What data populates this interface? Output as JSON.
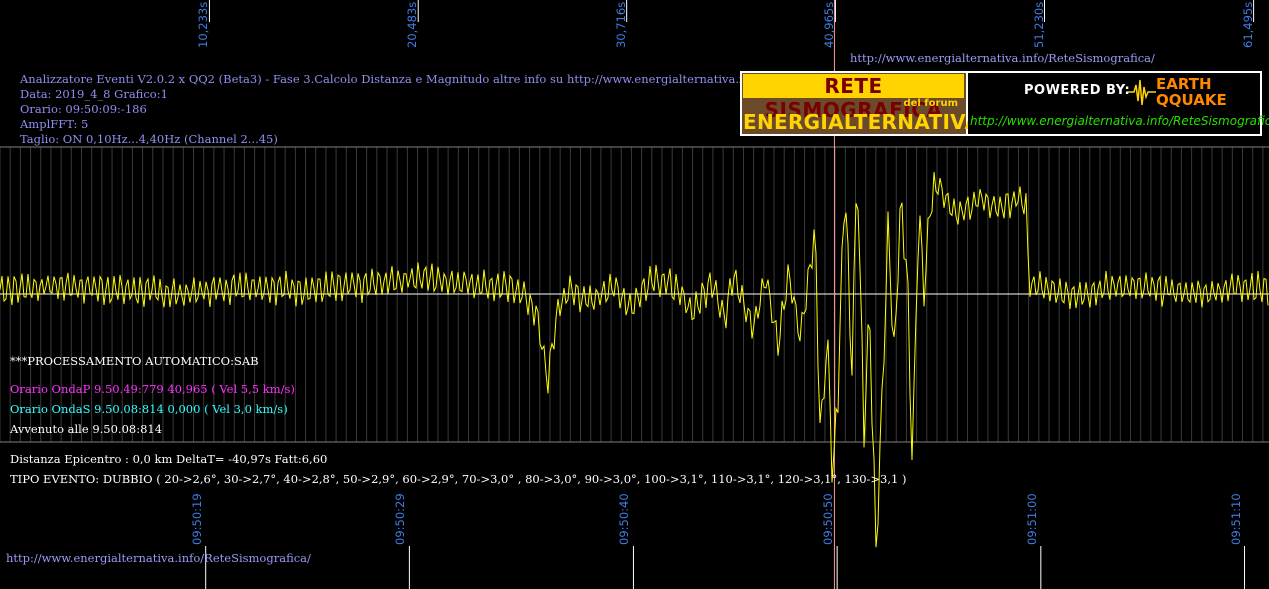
{
  "header": {
    "line1": "Analizzatore Eventi V2.0.2 x QQ2 (Beta3) - Fase 3.Calcolo Distanza e Magnitudo altre info su http://www.energialternativa.info/ReteSism",
    "line2": "Data: 2019_4_8 Grafico:1",
    "line3": "Orario: 09:50:09:-186",
    "line4": "AmplFFT: 5",
    "line5": "Taglio: ON 0,10Hz...4,40Hz       (Channel 2...45)"
  },
  "top_url": "http://www.energialternativa.info/ReteSismografica/",
  "bottom_url": "http://www.energialternativa.info/ReteSismografica/",
  "logo": {
    "title_top": "RETE SISMOGRAFICA",
    "subtitle": "del forum",
    "title_bottom": "ENERGIALTERNATIVA",
    "powered": "POWERED BY:",
    "brand_a": "EARTH",
    "brand_b": "QQUAKE",
    "url": "http://www.energialternativa.info/ReteSismografica"
  },
  "processing": {
    "title": "***PROCESSAMENTO AUTOMATICO:SAB",
    "p_wave": "Orario OndaP 9.50.49:779  40,965 ( Vel 5,5 km/s)",
    "s_wave": "Orario OndaS 9.50.08:814  0,000 ( Vel 3,0 km/s)",
    "occurred": "Avvenuto alle 9.50.08:814",
    "distance": "Distanza Epicentro : 0,0 km DeltaT= -40,97s  Fatt:6,60",
    "event_type": "TIPO EVENTO: DUBBIO ( 20->2,6°, 30->2,7°, 40->2,8°, 50->2,9°, 60->2,9°, 70->3,0° , 80->3,0°, 90->3,0°, 100->3,1°, 110->3,1°, 120->3,1°, 130->3,1 )"
  },
  "colors": {
    "background": "#000000",
    "signal": "#ffff00",
    "p_marker": "#ff9999",
    "p_text": "#ff33ff",
    "s_text": "#33ffff",
    "axis_label": "#3f7fe6",
    "grid": "#3a3a3a"
  },
  "chart_data": {
    "type": "line",
    "top_ticks": [
      "10,233s",
      "20,483s",
      "30,716s",
      "40,965s",
      "51,230s",
      "61,495s"
    ],
    "bottom_ticks": [
      "09:50:19",
      "09:50:29",
      "09:50:40",
      "09:50:50",
      "09:51:00",
      "09:51:10"
    ],
    "x_range_s": [
      0,
      62.3
    ],
    "p_marker_s": 40.965,
    "y_range": [
      -6.5,
      3.5
    ],
    "x": [
      0,
      3,
      6,
      9,
      12,
      15,
      18,
      20.5,
      22,
      24,
      25.5,
      26.3,
      26.9,
      27.4,
      28,
      29,
      30,
      31,
      32,
      33,
      34,
      35,
      35.6,
      36,
      37,
      37.6,
      38.2,
      38.7,
      39.3,
      40,
      40.3,
      40.6,
      40.9,
      41.2,
      41.5,
      41.8,
      42.1,
      42.4,
      42.7,
      43.0,
      43.3,
      43.6,
      43.9,
      44.2,
      44.5,
      44.8,
      45.1,
      45.4,
      45.7,
      46,
      47,
      48,
      49,
      50,
      50.4,
      50.5,
      51.5,
      53,
      55,
      57,
      59,
      61,
      62.3
    ],
    "y": [
      0.1,
      0.2,
      0.1,
      0.0,
      0.2,
      0.1,
      0.2,
      0.4,
      0.3,
      0.2,
      0.1,
      -0.4,
      -2.0,
      -0.3,
      0.1,
      -0.2,
      0.2,
      -0.3,
      0.4,
      0.2,
      -0.4,
      0.3,
      -0.6,
      0.5,
      -0.8,
      0.4,
      -1.2,
      0.5,
      -1.0,
      1.5,
      -3.5,
      -0.8,
      -4.5,
      -1.5,
      2.8,
      -2.0,
      3.0,
      -3.2,
      -0.5,
      -6.0,
      -2.5,
      1.6,
      -1.5,
      2.0,
      0.8,
      -3.8,
      1.8,
      0.2,
      2.3,
      2.6,
      1.8,
      2.2,
      2.0,
      2.2,
      2.1,
      0.2,
      0.1,
      0.0,
      0.2,
      0.1,
      0.0,
      0.2,
      0.1
    ]
  }
}
